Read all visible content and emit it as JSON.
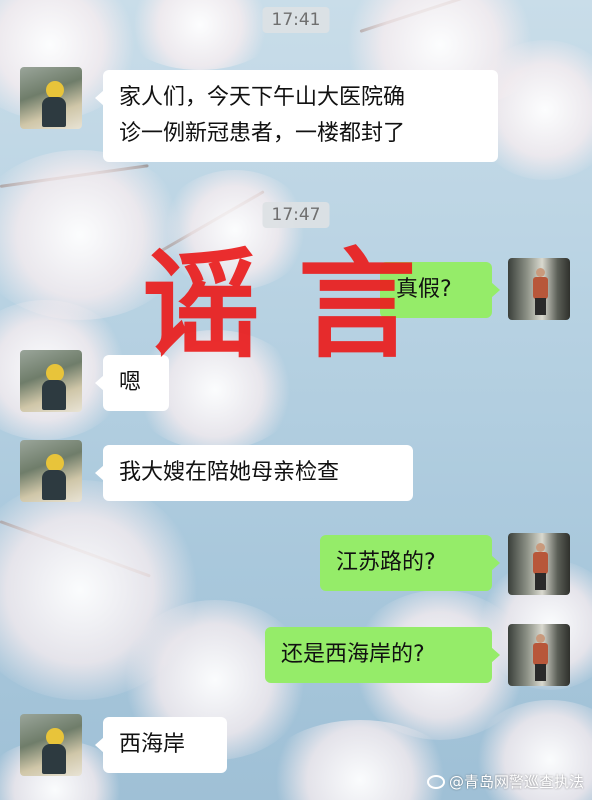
{
  "timestamps": [
    "17:41",
    "17:47"
  ],
  "messages": [
    {
      "side": "left",
      "text": "家人们，今天下午山大医院确\n诊一例新冠患者，一楼都封了"
    },
    {
      "side": "right",
      "text": "真假?"
    },
    {
      "side": "left",
      "text": "嗯"
    },
    {
      "side": "left",
      "text": "我大嫂在陪她母亲检查"
    },
    {
      "side": "right",
      "text": "江苏路的?"
    },
    {
      "side": "right",
      "text": "还是西海岸的?"
    },
    {
      "side": "left",
      "text": "西海岸"
    }
  ],
  "stamp_text": "谣言",
  "watermark": "@青岛网警巡查执法",
  "colors": {
    "bubble_right": "#95ec69",
    "bubble_left": "#ffffff",
    "stamp": "#ea1e1e"
  }
}
